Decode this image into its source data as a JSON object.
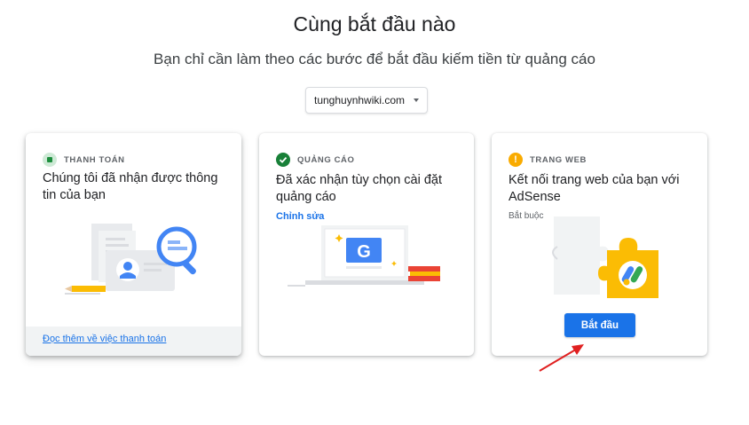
{
  "header": {
    "title": "Cùng bắt đầu nào",
    "subtitle": "Bạn chỉ cần làm theo các bước để bắt đầu kiếm tiền từ quảng cáo"
  },
  "site_selector": {
    "value": "tunghuynhwiki.com"
  },
  "cards": [
    {
      "category": "THANH TOÁN",
      "icon": "billing-icon",
      "title": "Chúng tôi đã nhận được thông tin của bạn",
      "footer_link": "Đọc thêm về việc thanh toán"
    },
    {
      "category": "QUẢNG CÁO",
      "icon": "check-circle-icon",
      "title": "Đã xác nhận tùy chọn cài đặt quảng cáo",
      "action_link": "Chỉnh sửa",
      "illustration_letter": "G"
    },
    {
      "category": "TRANG WEB",
      "icon": "warning-icon",
      "title": "Kết nối trang web của bạn với AdSense",
      "status": "Bắt buộc",
      "button": "Bắt đầu",
      "warning_glyph": "!"
    }
  ],
  "colors": {
    "primary_blue": "#1a73e8",
    "success_green": "#188038",
    "warning_yellow": "#f9ab00",
    "annotation_red": "#e02020"
  }
}
